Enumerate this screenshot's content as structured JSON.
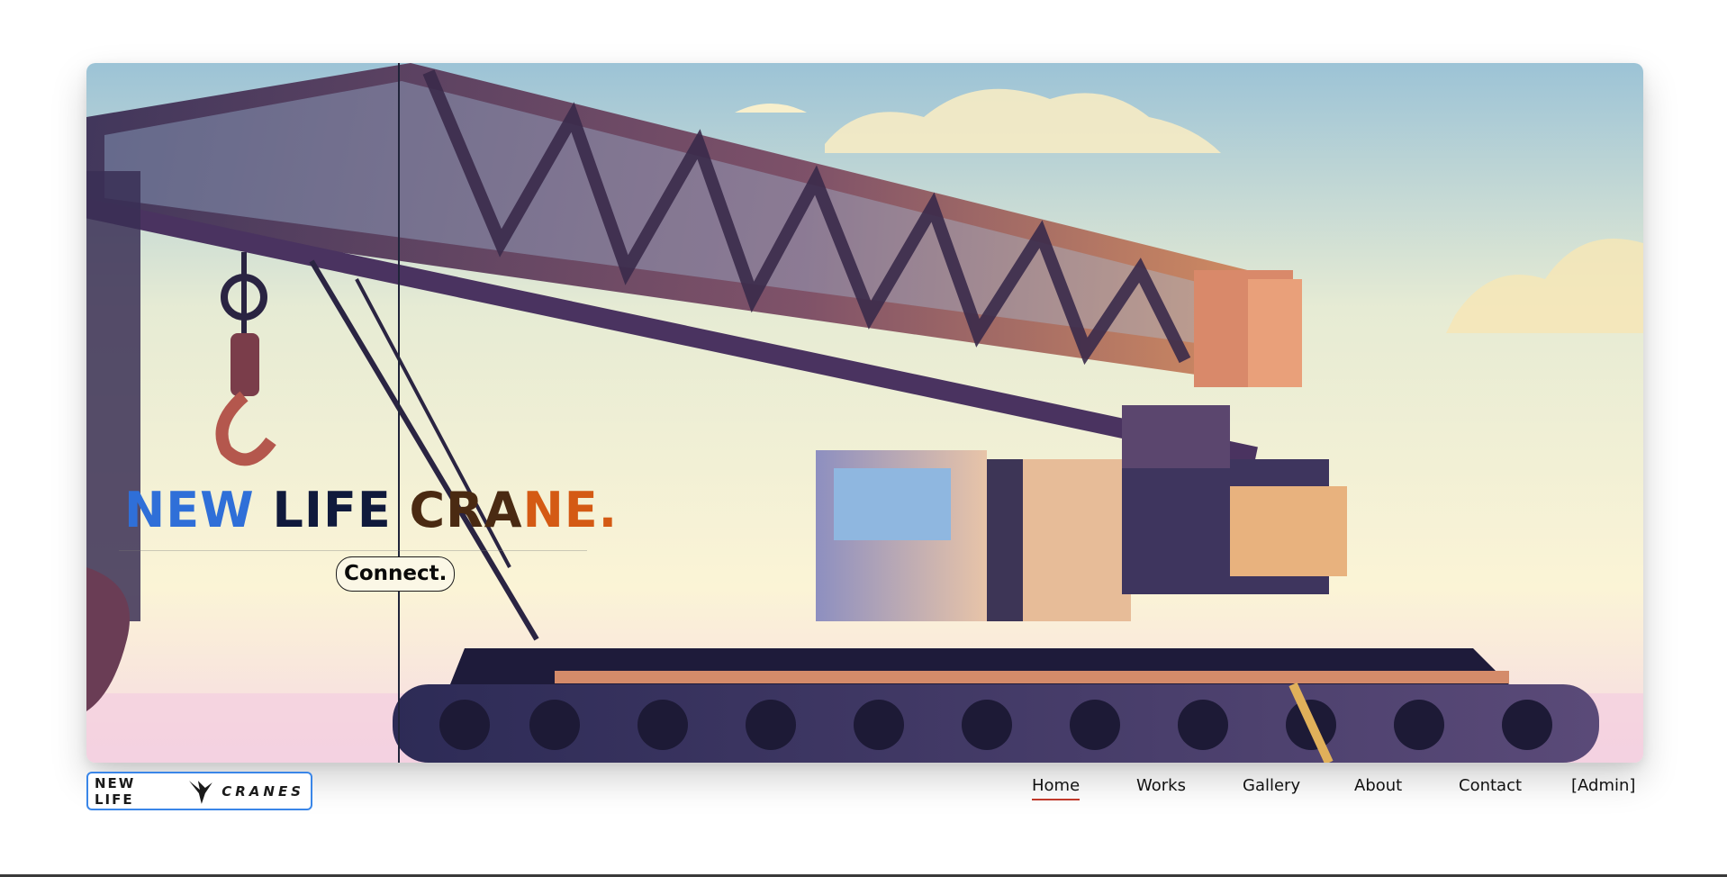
{
  "hero": {
    "title_part1": "NEW",
    "title_part2": " LIFE ",
    "title_part3": "CRA",
    "title_part4": "NE.",
    "connect_label": "Connect.",
    "image": "crane-illustration"
  },
  "logo": {
    "text_left": "NEW LIFE",
    "text_right": "CRANES",
    "icon": "bird-icon"
  },
  "nav": {
    "items": [
      {
        "label": "Home",
        "active": true
      },
      {
        "label": "Works",
        "active": false
      },
      {
        "label": "Gallery",
        "active": false
      },
      {
        "label": "About",
        "active": false
      },
      {
        "label": "Contact",
        "active": false
      },
      {
        "label": "[Admin]",
        "active": false
      }
    ]
  },
  "colors": {
    "accent_blue": "#3a86e8",
    "active_underline": "#c0392b",
    "title_blue": "#2f6fd8",
    "title_orange": "#d45a14"
  }
}
